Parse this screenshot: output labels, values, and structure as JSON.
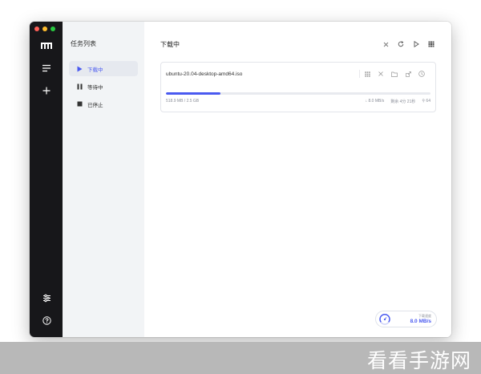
{
  "rail": {
    "items": [
      {
        "name": "menu-icon"
      },
      {
        "name": "add-task-icon"
      },
      {
        "name": "settings-icon"
      },
      {
        "name": "help-icon"
      }
    ]
  },
  "sidebar": {
    "title": "任务列表",
    "items": [
      {
        "label": "下载中",
        "icon": "play-icon",
        "active": true
      },
      {
        "label": "等待中",
        "icon": "pause-icon",
        "active": false
      },
      {
        "label": "已停止",
        "icon": "stop-icon",
        "active": false
      }
    ]
  },
  "main": {
    "title": "下载中",
    "toolbar": [
      "close-icon",
      "refresh-icon",
      "play-icon",
      "grid-icon"
    ]
  },
  "task": {
    "name": "ubuntu-20.04-desktop-amd64.iso",
    "size": "518.9 MB / 2.5 GB",
    "progress": 0.205,
    "speed": "↓ 8.0 MB/s",
    "remaining": "剩余 4分 21秒",
    "connections": "⚲ 64",
    "actions": [
      "grid-icon",
      "close-icon",
      "folder-icon",
      "link-icon",
      "info-icon"
    ]
  },
  "speed_widget": {
    "label": "下载速度",
    "value": "8.0 MB/s"
  },
  "colors": {
    "accent": "#4a5af0",
    "rail": "#17171a",
    "sidebar": "#f2f4f6",
    "traffic_red": "#ff5f57",
    "traffic_yellow": "#ffbd2e",
    "traffic_green": "#28c940"
  },
  "watermark": "看看手游网"
}
